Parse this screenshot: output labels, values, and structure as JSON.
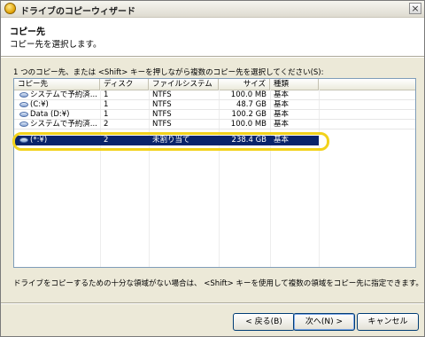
{
  "window": {
    "title": "ドライブのコピーウィザード",
    "close_label": "×"
  },
  "header": {
    "title": "コピー先",
    "subtitle": "コピー先を選択します。"
  },
  "instruction": "1 つのコピー先、または <Shift> キーを押しながら複数のコピー先を選択してください(S):",
  "list": {
    "columns": [
      "コピー先",
      "ディスク",
      "ファイルシステム",
      "サイズ",
      "種類"
    ],
    "rows": [
      {
        "dest": "システムで予約済...",
        "disk": "1",
        "fs": "NTFS",
        "size": "100.0 MB",
        "type": "基本",
        "selected": false
      },
      {
        "dest": "(C:¥)",
        "disk": "1",
        "fs": "NTFS",
        "size": "48.7 GB",
        "type": "基本",
        "selected": false
      },
      {
        "dest": "Data (D:¥)",
        "disk": "1",
        "fs": "NTFS",
        "size": "100.2 GB",
        "type": "基本",
        "selected": false
      },
      {
        "dest": "システムで予約済...",
        "disk": "2",
        "fs": "NTFS",
        "size": "100.0 MB",
        "type": "基本",
        "selected": false
      },
      {
        "dest": "(*:¥)",
        "disk": "2",
        "fs": "未割り当て",
        "size": "238.4 GB",
        "type": "基本",
        "selected": true
      }
    ]
  },
  "note": "ドライブをコピーするための十分な領域がない場合は、 <Shift> キーを使用して複数の領域をコピー先に指定できます。",
  "buttons": {
    "back": "< 戻る(B)",
    "next": "次へ(N) >",
    "cancel": "キャンセル"
  }
}
